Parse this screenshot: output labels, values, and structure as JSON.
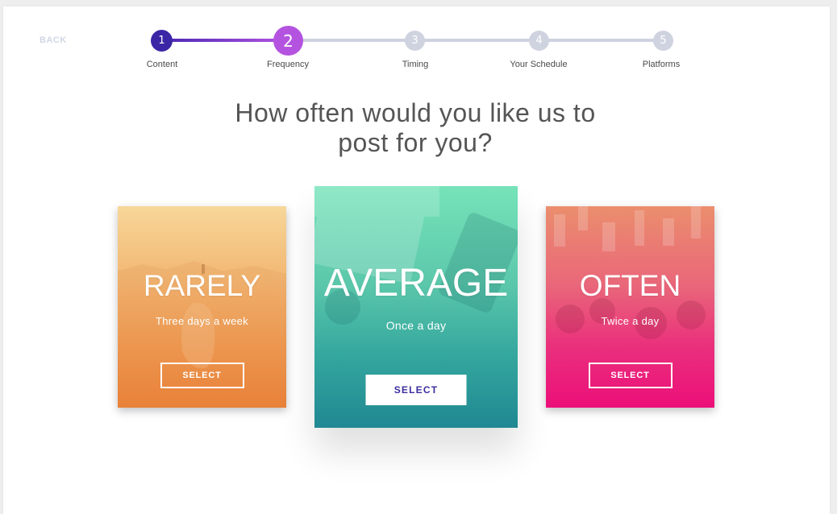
{
  "nav": {
    "back_label": "BACK"
  },
  "stepper": {
    "steps": [
      {
        "number": "1",
        "label": "Content"
      },
      {
        "number": "2",
        "label": "Frequency"
      },
      {
        "number": "3",
        "label": "Timing"
      },
      {
        "number": "4",
        "label": "Your Schedule"
      },
      {
        "number": "5",
        "label": "Platforms"
      }
    ],
    "current_step": 2
  },
  "question": {
    "line1": "How often would you like us to",
    "line2": "post for you?"
  },
  "options": [
    {
      "title": "RARELY",
      "subtitle": "Three days a week",
      "button": "SELECT"
    },
    {
      "title": "AVERAGE",
      "subtitle": "Once a day",
      "button": "SELECT"
    },
    {
      "title": "OFTEN",
      "subtitle": "Twice a day",
      "button": "SELECT"
    }
  ],
  "colors": {
    "step_complete": "#3b26a6",
    "step_current": "#b453e0",
    "step_pending": "#cfd3e0",
    "rarely_gradient_end": "#ea6f22",
    "average_gradient_end": "#208893",
    "often_gradient_end": "#ec0f7a"
  }
}
